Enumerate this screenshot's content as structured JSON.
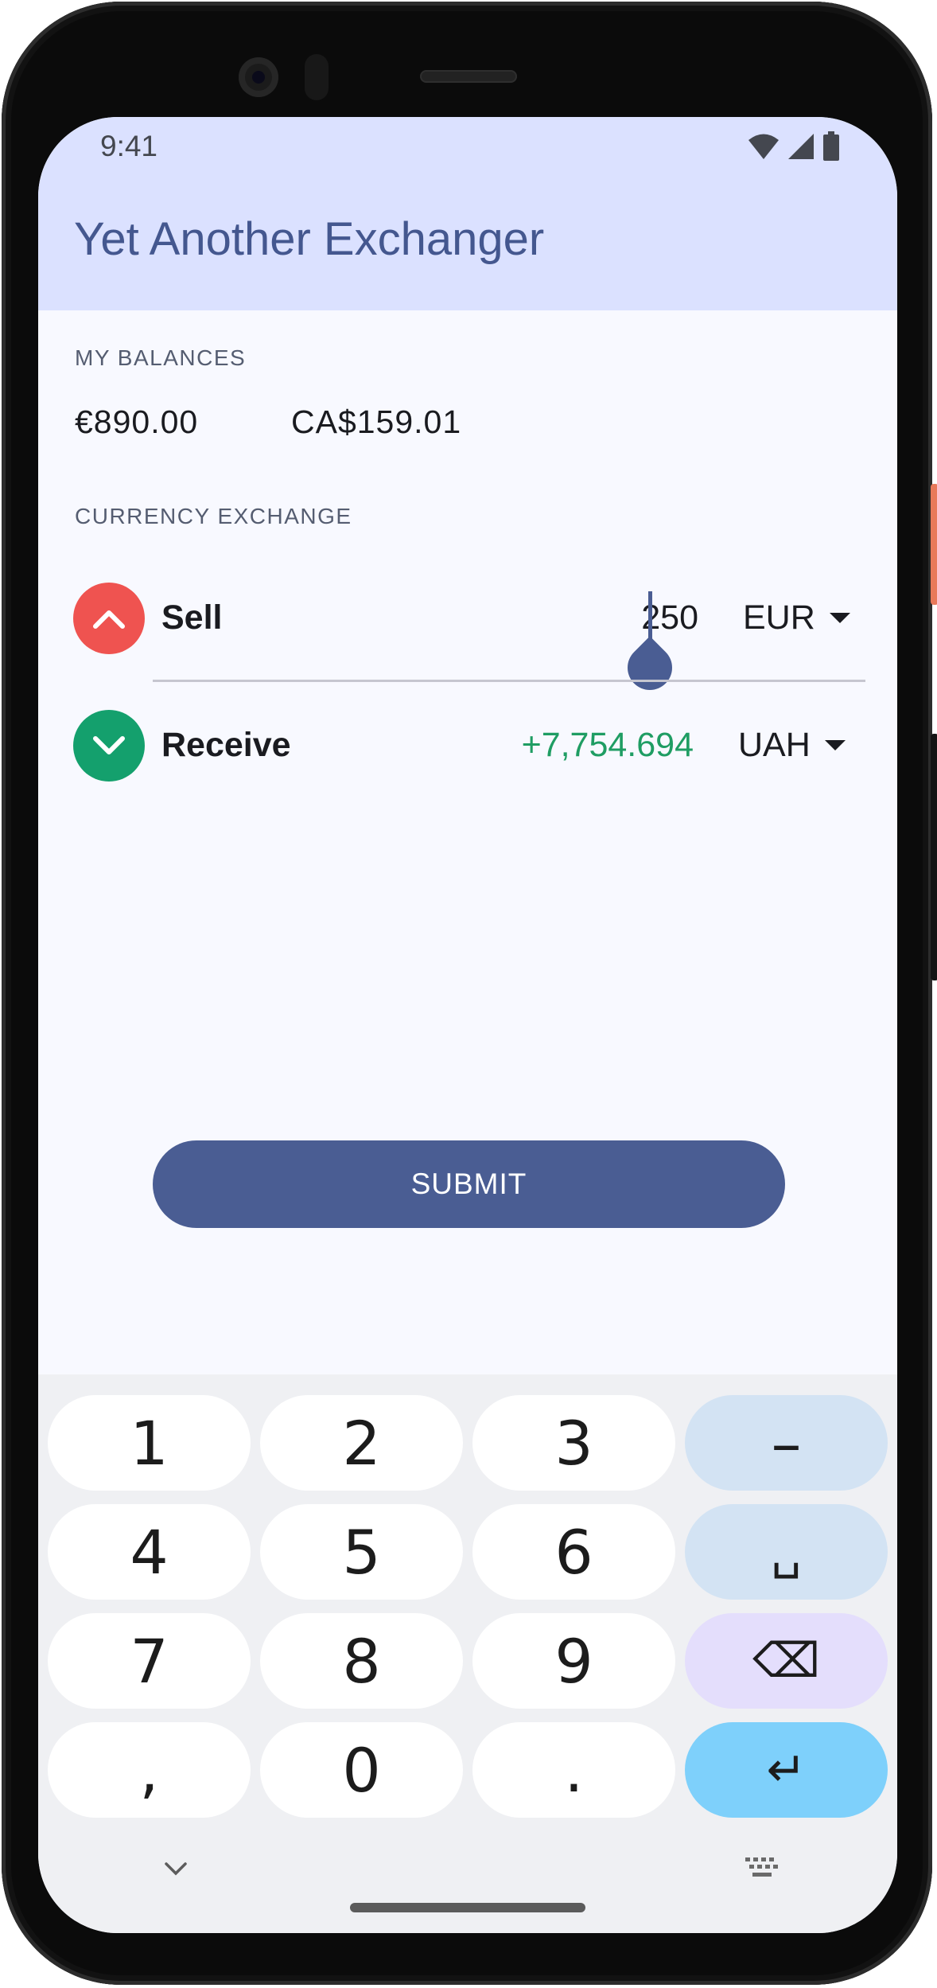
{
  "status_bar": {
    "time": "9:41"
  },
  "app": {
    "title": "Yet Another Exchanger"
  },
  "balances": {
    "label": "MY BALANCES",
    "items": [
      "€890.00",
      "CA$159.01"
    ]
  },
  "exchange": {
    "label": "CURRENCY EXCHANGE",
    "sell": {
      "label": "Sell",
      "amount": "250",
      "currency": "EUR"
    },
    "receive": {
      "label": "Receive",
      "amount": "+7,754.694",
      "currency": "UAH"
    }
  },
  "submit_label": "SUBMIT",
  "keyboard": {
    "rows": [
      [
        "1",
        "2",
        "3",
        "–"
      ],
      [
        "4",
        "5",
        "6",
        "␣"
      ],
      [
        "7",
        "8",
        "9",
        "⌫"
      ],
      [
        ",",
        "0",
        ".",
        "↵"
      ]
    ]
  },
  "colors": {
    "primary": "#4a5d93",
    "app_bar": "#dbe1ff",
    "sell": "#ef5350",
    "receive": "#14a06d",
    "receive_amount": "#1f9d63",
    "enter_key": "#7ed0fb"
  },
  "icons": {
    "sell": "chevron-up-icon",
    "receive": "chevron-down-icon",
    "keyboard_hide": "chevron-down-icon",
    "keyboard_switch": "keyboard-icon"
  }
}
